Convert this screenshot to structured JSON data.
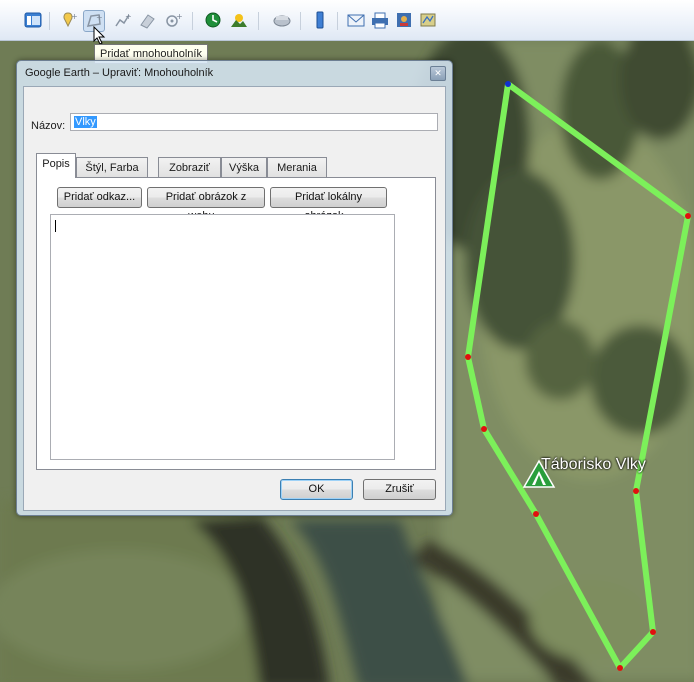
{
  "toolbar": {
    "tooltip": "Pridať mnohouholník",
    "icons": [
      "sidebar-icon",
      "add-placemark-icon",
      "add-polygon-icon",
      "add-path-icon",
      "add-image-overlay-icon",
      "record-tour-icon",
      "historical-imagery-icon",
      "sunlight-icon",
      "planets-icon",
      "ruler-icon",
      "email-icon",
      "print-icon",
      "save-image-icon",
      "maps-icon"
    ]
  },
  "dialog": {
    "title": "Google Earth – Upraviť: Mnohouholník",
    "name_label": "Názov:",
    "name_value": "Vlky",
    "tabs": [
      {
        "label": "Popis",
        "active": true
      },
      {
        "label": "Štýl, Farba",
        "active": false
      },
      {
        "label": "Zobraziť",
        "active": false
      },
      {
        "label": "Výška",
        "active": false
      },
      {
        "label": "Merania",
        "active": false
      }
    ],
    "buttons": {
      "add_link": "Pridať odkaz...",
      "add_web_image": "Pridať obrázok z webu...",
      "add_local_image": "Pridať lokálny obrázok...",
      "ok": "OK",
      "cancel": "Zrušiť"
    },
    "description": ""
  },
  "map": {
    "placemark_label": "Táborisko Vlky",
    "polygon_color": "#7cf05a",
    "vertex_color": "#e01010",
    "active_vertex_color": "#1030d0"
  }
}
